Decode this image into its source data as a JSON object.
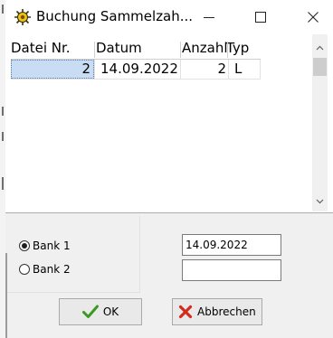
{
  "window": {
    "title": "Buchung Sammelzah...",
    "controls": {
      "minimize": "—",
      "maximize": "☐",
      "close": "✕"
    }
  },
  "grid": {
    "columns": [
      "Datei Nr.",
      "Datum",
      "Anzahl",
      "Typ"
    ],
    "rows": [
      {
        "datei_nr": "2",
        "datum": "14.09.2022",
        "anzahl": "2",
        "typ": "L"
      }
    ],
    "scrollbar": {
      "up_arrow": "chevron-up-icon",
      "down_arrow": "chevron-down-icon"
    }
  },
  "bank_selection": {
    "options": [
      {
        "label": "Bank 1",
        "selected": true
      },
      {
        "label": "Bank 2",
        "selected": false
      }
    ],
    "date_value_1": "14.09.2022",
    "date_value_2": ""
  },
  "buttons": {
    "ok_label": "OK",
    "cancel_label": "Abbrechen",
    "ok_icon": "checkmark-icon",
    "cancel_icon": "red-x-icon",
    "ok_icon_color": "#3a9a1e",
    "cancel_icon_color": "#d42a1c"
  },
  "colors": {
    "selected_cell": "#c8ddf4",
    "window_bg": "#f0f0f0"
  }
}
